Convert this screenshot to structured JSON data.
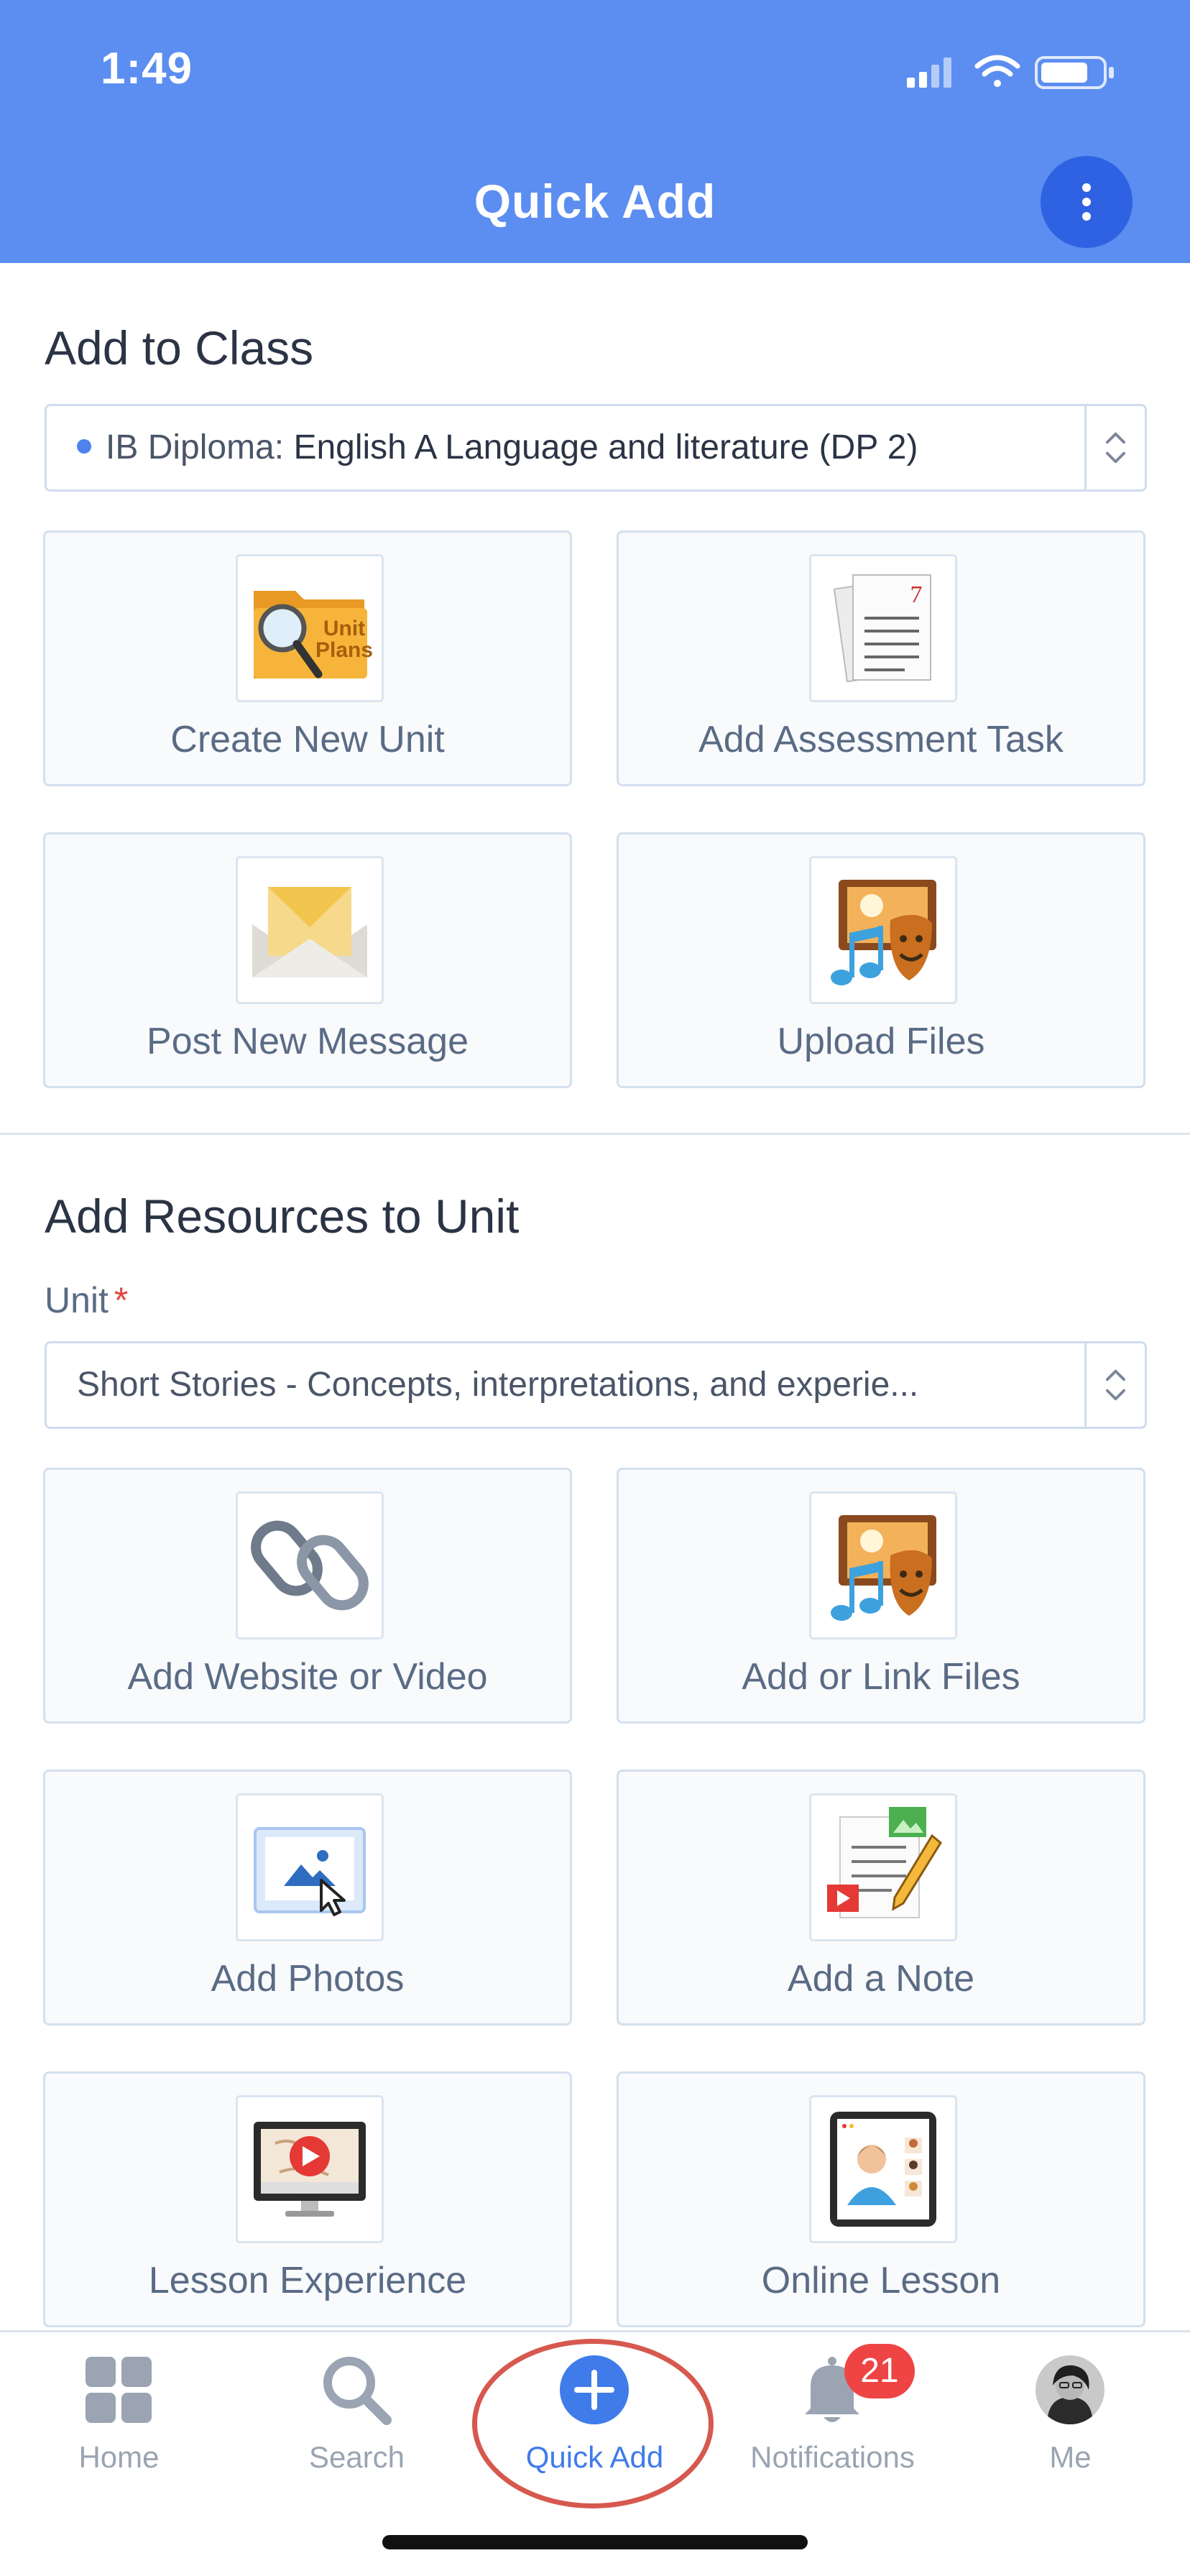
{
  "status_bar": {
    "time": "1:49"
  },
  "header": {
    "title": "Quick Add"
  },
  "add_to_class": {
    "title": "Add to Class",
    "class_select": {
      "prefix": "IB Diploma:",
      "value": "English A Language and literature (DP 2)"
    },
    "actions": [
      {
        "label": "Create New Unit",
        "icon": "unit-plans-folder-icon"
      },
      {
        "label": "Add Assessment Task",
        "icon": "assessment-document-icon"
      },
      {
        "label": "Post New Message",
        "icon": "envelope-icon"
      },
      {
        "label": "Upload Files",
        "icon": "media-files-icon"
      }
    ],
    "unit_plans_icon_text": [
      "Unit",
      "Plans"
    ],
    "assessment_icon_number": "7"
  },
  "add_resources": {
    "title": "Add Resources to Unit",
    "unit_label": "Unit",
    "required_mark": "*",
    "unit_select": {
      "value": "Short Stories - Concepts, interpretations, and experie..."
    },
    "actions": [
      {
        "label": "Add Website or Video",
        "icon": "chain-link-icon"
      },
      {
        "label": "Add or Link Files",
        "icon": "media-files-icon"
      },
      {
        "label": "Add Photos",
        "icon": "photo-icon"
      },
      {
        "label": "Add a Note",
        "icon": "note-icon"
      },
      {
        "label": "Lesson Experience",
        "icon": "video-lesson-icon"
      },
      {
        "label": "Online Lesson",
        "icon": "online-lesson-icon"
      }
    ]
  },
  "bottom_nav": {
    "items": [
      {
        "label": "Home",
        "icon": "grid-icon"
      },
      {
        "label": "Search",
        "icon": "search-icon"
      },
      {
        "label": "Quick Add",
        "icon": "plus-circle-icon",
        "active": true
      },
      {
        "label": "Notifications",
        "icon": "bell-icon",
        "badge": "21"
      },
      {
        "label": "Me",
        "icon": "avatar"
      }
    ]
  },
  "colors": {
    "header_bg": "#5b8ef0",
    "accent": "#3f7be9",
    "badge": "#ee4444",
    "highlight_ring": "#d6584f"
  }
}
